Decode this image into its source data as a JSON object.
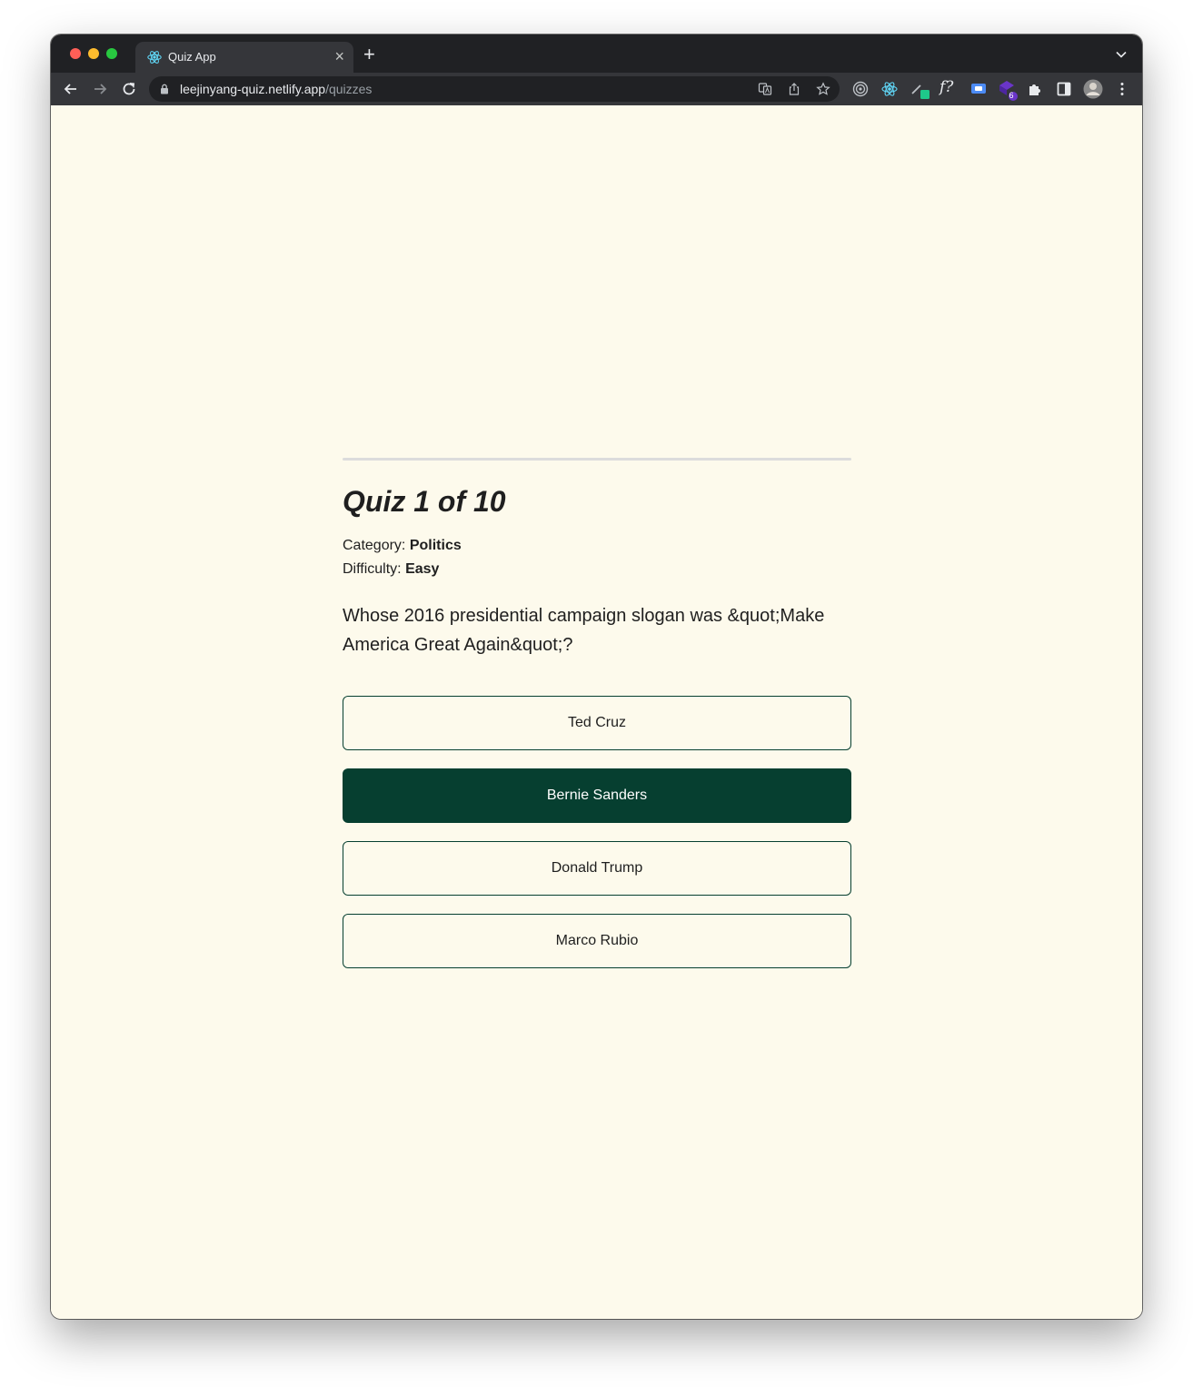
{
  "browser": {
    "tab_title": "Quiz App",
    "url_host": "leejinyang-quiz.netlify.app",
    "url_path": "/quizzes",
    "extension_badges": {
      "extension_3": "",
      "extension_6": "6"
    },
    "icons": [
      "back-arrow-icon",
      "forward-arrow-icon",
      "reload-icon",
      "lock-icon",
      "translate-icon",
      "share-icon",
      "star-icon",
      "extensions-icon",
      "side-panel-icon",
      "profile-avatar",
      "more-menu-icon"
    ]
  },
  "quiz": {
    "title": "Quiz 1 of 10",
    "progress_fraction": 0,
    "category_label": "Category:",
    "category_value": "Politics",
    "difficulty_label": "Difficulty:",
    "difficulty_value": "Easy",
    "question": "Whose 2016 presidential campaign slogan was &quot;Make America Great Again&quot;?",
    "answers": [
      {
        "label": "Ted Cruz",
        "selected": false
      },
      {
        "label": "Bernie Sanders",
        "selected": true
      },
      {
        "label": "Donald Trump",
        "selected": false
      },
      {
        "label": "Marco Rubio",
        "selected": false
      }
    ]
  },
  "colors": {
    "page_background": "#fdfaec",
    "accent": "#063f30",
    "text": "#1f1f1f",
    "progress_track": "#dcdcdc"
  }
}
